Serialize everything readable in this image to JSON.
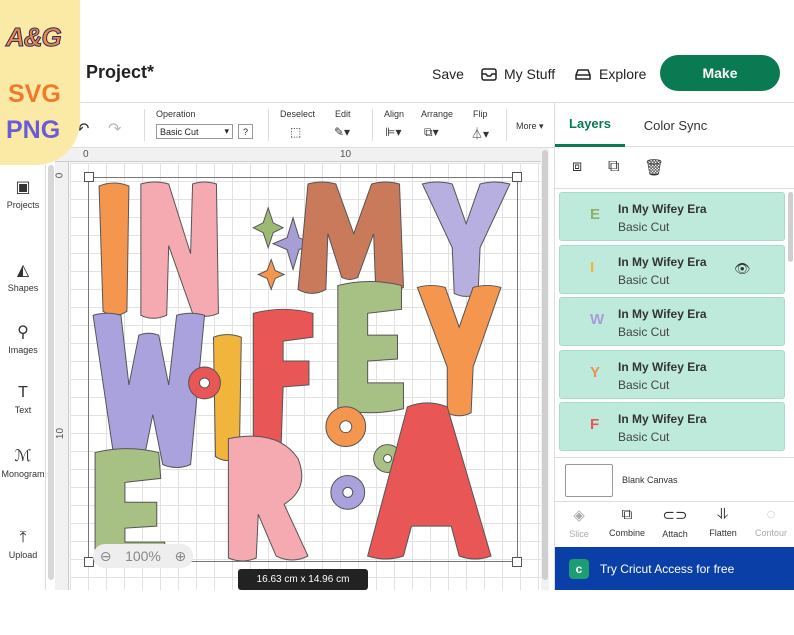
{
  "header": {
    "project_title": "ed Project*",
    "save_label": "Save",
    "my_stuff_label": "My Stuff",
    "explore_label": "Explore",
    "make_label": "Make"
  },
  "watermark": {
    "ag": "A&G",
    "svg": "SVG",
    "png": "PNG"
  },
  "toolbar": {
    "operation_label": "Operation",
    "operation_value": "Basic Cut",
    "help_label": "?",
    "deselect_label": "Deselect",
    "edit_label": "Edit",
    "align_label": "Align",
    "arrange_label": "Arrange",
    "flip_label": "Flip",
    "more_label": "More"
  },
  "left_nav": {
    "items": [
      {
        "label": "Projects",
        "icon": "projects-icon"
      },
      {
        "label": "Shapes",
        "icon": "shapes-icon"
      },
      {
        "label": "Images",
        "icon": "images-icon"
      },
      {
        "label": "Text",
        "icon": "text-icon"
      },
      {
        "label": "Monogram",
        "icon": "monogram-icon"
      },
      {
        "label": "Upload",
        "icon": "upload-icon"
      }
    ]
  },
  "canvas": {
    "ruler_top": [
      "0",
      "10"
    ],
    "ruler_left": [
      "0",
      "10"
    ],
    "zoom": "100%",
    "dimensions": "16.63  cm x 14.96  cm",
    "design_words": [
      "IN",
      "MY",
      "WIFEY",
      "ERA"
    ]
  },
  "right_panel": {
    "tabs": [
      "Layers",
      "Color Sync"
    ],
    "layers": [
      {
        "letter": "E",
        "name": "In My Wifey Era",
        "type": "Basic Cut",
        "color": "#8fae6b",
        "visible_icon": false
      },
      {
        "letter": "I",
        "name": "In My Wifey Era",
        "type": "Basic Cut",
        "color": "#f2b53c",
        "visible_icon": true
      },
      {
        "letter": "W",
        "name": "In My Wifey Era",
        "type": "Basic Cut",
        "color": "#a79ed6",
        "visible_icon": false
      },
      {
        "letter": "Y",
        "name": "In My Wifey Era",
        "type": "Basic Cut",
        "color": "#f28c4a",
        "visible_icon": false
      },
      {
        "letter": "F",
        "name": "In My Wifey Era",
        "type": "Basic Cut",
        "color": "#e85656",
        "visible_icon": false
      }
    ],
    "blank_canvas_label": "Blank Canvas",
    "actions": [
      {
        "label": "Slice",
        "disabled": true
      },
      {
        "label": "Combine",
        "disabled": false
      },
      {
        "label": "Attach",
        "disabled": false
      },
      {
        "label": "Flatten",
        "disabled": false
      },
      {
        "label": "Contour",
        "disabled": true
      }
    ],
    "banner_label": "Try Cricut Access for free"
  },
  "colors": {
    "brand_green": "#0a7a52",
    "layer_bg": "#bdeadb",
    "banner_blue": "#0b3fa8"
  }
}
